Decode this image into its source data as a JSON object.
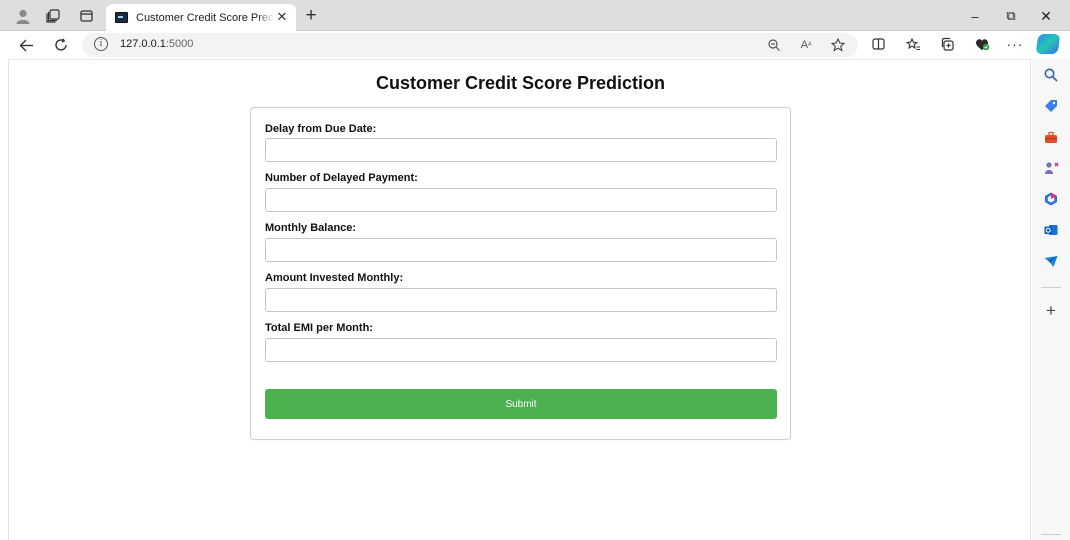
{
  "browser": {
    "tab_title": "Customer Credit Score Prediction",
    "url_host": "127.0.0.1",
    "url_port": ":5000",
    "new_tab_glyph": "+",
    "tab_close_glyph": "✕",
    "window_controls": {
      "minimize": "–",
      "restore": "⧉",
      "close": "✕"
    },
    "icons": [
      "profile-icon",
      "workspaces-icon",
      "tab-actions-icon",
      "back-icon",
      "refresh-icon",
      "info-icon",
      "zoom-out-icon",
      "read-aloud-icon",
      "favorite-star-icon",
      "split-screen-icon",
      "favorites-icon",
      "collections-icon",
      "extensions-icon",
      "more-icon",
      "copilot-icon"
    ]
  },
  "page": {
    "title": "Customer Credit Score Prediction",
    "fields": [
      {
        "label": "Delay from Due Date:",
        "value": "",
        "placeholder": ""
      },
      {
        "label": "Number of Delayed Payment:",
        "value": "",
        "placeholder": ""
      },
      {
        "label": "Monthly Balance:",
        "value": "",
        "placeholder": ""
      },
      {
        "label": "Amount Invested Monthly:",
        "value": "",
        "placeholder": ""
      },
      {
        "label": "Total EMI per Month:",
        "value": "",
        "placeholder": ""
      }
    ],
    "submit_label": "Submit"
  },
  "sidebar": {
    "icons": [
      "search-icon",
      "shopping-tag-icon",
      "tools-icon",
      "games-icon",
      "microsoft365-icon",
      "outlook-icon",
      "telegram-icon",
      "add-icon"
    ],
    "add_glyph": "+"
  },
  "colors": {
    "submit_bg": "#4caf50",
    "tab_bar_bg": "#dedede"
  }
}
